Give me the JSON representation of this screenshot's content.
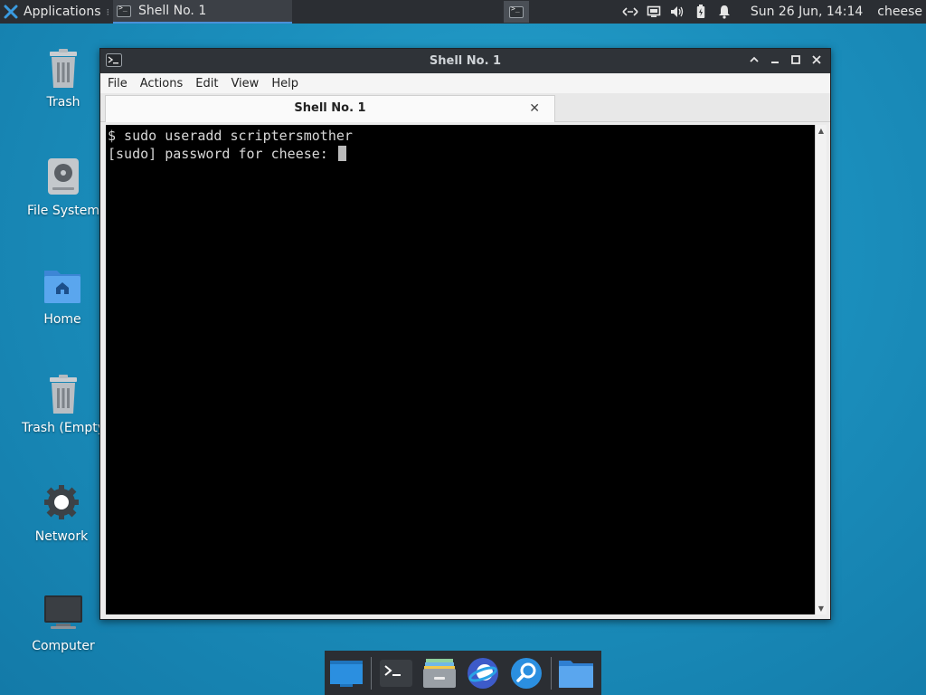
{
  "top_panel": {
    "applications_label": "Applications",
    "separator_glyph": "⁝",
    "active_task_label": "Shell No. 1",
    "clock": "Sun 26 Jun, 14:14",
    "user": "cheese"
  },
  "desktop_icons": [
    {
      "label": "Trash",
      "icon": "trash-icon"
    },
    {
      "label": "File System",
      "icon": "drive-icon"
    },
    {
      "label": "Home",
      "icon": "home-folder-icon"
    },
    {
      "label": "Trash (Empty",
      "icon": "trash-empty-icon"
    },
    {
      "label": "Network",
      "icon": "network-icon"
    },
    {
      "label": "Computer",
      "icon": "computer-icon"
    }
  ],
  "window": {
    "title": "Shell No. 1",
    "menu": [
      "File",
      "Actions",
      "Edit",
      "View",
      "Help"
    ],
    "tab_label": "Shell No. 1",
    "tab_close_glyph": "✕",
    "terminal_lines": [
      "$ sudo useradd scriptersmother",
      "[sudo] password for cheese: "
    ]
  },
  "dock": {
    "items": [
      "show-desktop-icon",
      "terminal-icon",
      "file-manager-icon",
      "web-browser-icon",
      "search-icon",
      "folder-icon"
    ]
  },
  "colors": {
    "desktop_bg": "#1b8fbd",
    "panel_bg": "#2b2e33",
    "terminal_bg": "#000000",
    "terminal_fg": "#d8d8d8",
    "accent": "#4a90d9"
  }
}
